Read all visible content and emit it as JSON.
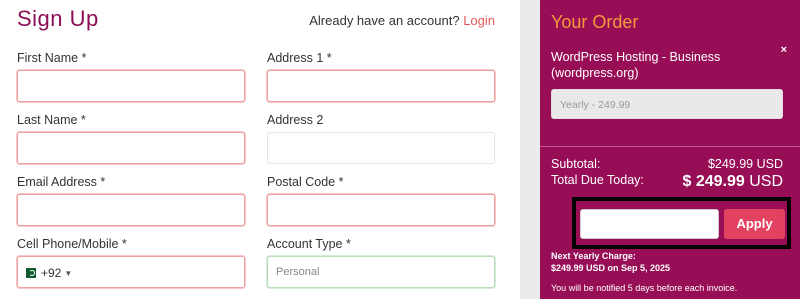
{
  "form": {
    "title": "Sign Up",
    "already_text": "Already have an account?",
    "login_link": "Login",
    "fields": {
      "first_name": {
        "label": "First Name *",
        "value": ""
      },
      "address1": {
        "label": "Address 1 *",
        "value": ""
      },
      "last_name": {
        "label": "Last Name *",
        "value": ""
      },
      "address2": {
        "label": "Address 2",
        "value": ""
      },
      "email": {
        "label": "Email Address *",
        "value": ""
      },
      "postal": {
        "label": "Postal Code *",
        "value": ""
      },
      "phone": {
        "label": "Cell Phone/Mobile *",
        "country_code": "+92",
        "value": ""
      },
      "account_type": {
        "label": "Account Type *",
        "value": "Personal"
      }
    }
  },
  "order": {
    "title": "Your Order",
    "item_name": "WordPress Hosting - Business (wordpress.org)",
    "billing_cycle": "Yearly - 249.99",
    "subtotal_label": "Subtotal:",
    "subtotal_value": "$249.99 USD",
    "total_label": "Total Due Today:",
    "total_amount": "$ 249.99",
    "total_currency": "USD",
    "promo_value": "",
    "apply_label": "Apply",
    "next_charge_line1": "Next Yearly Charge:",
    "next_charge_line2": "$249.99 USD on Sep 5, 2025",
    "notify_text": "You will be notified 5 days before each invoice.",
    "remove_icon": "×"
  },
  "colors": {
    "brand": "#970e57",
    "title": "#8c0f55",
    "accent_orange": "#f39a3c",
    "apply": "#e34160",
    "error_border": "#f0a0a0"
  }
}
